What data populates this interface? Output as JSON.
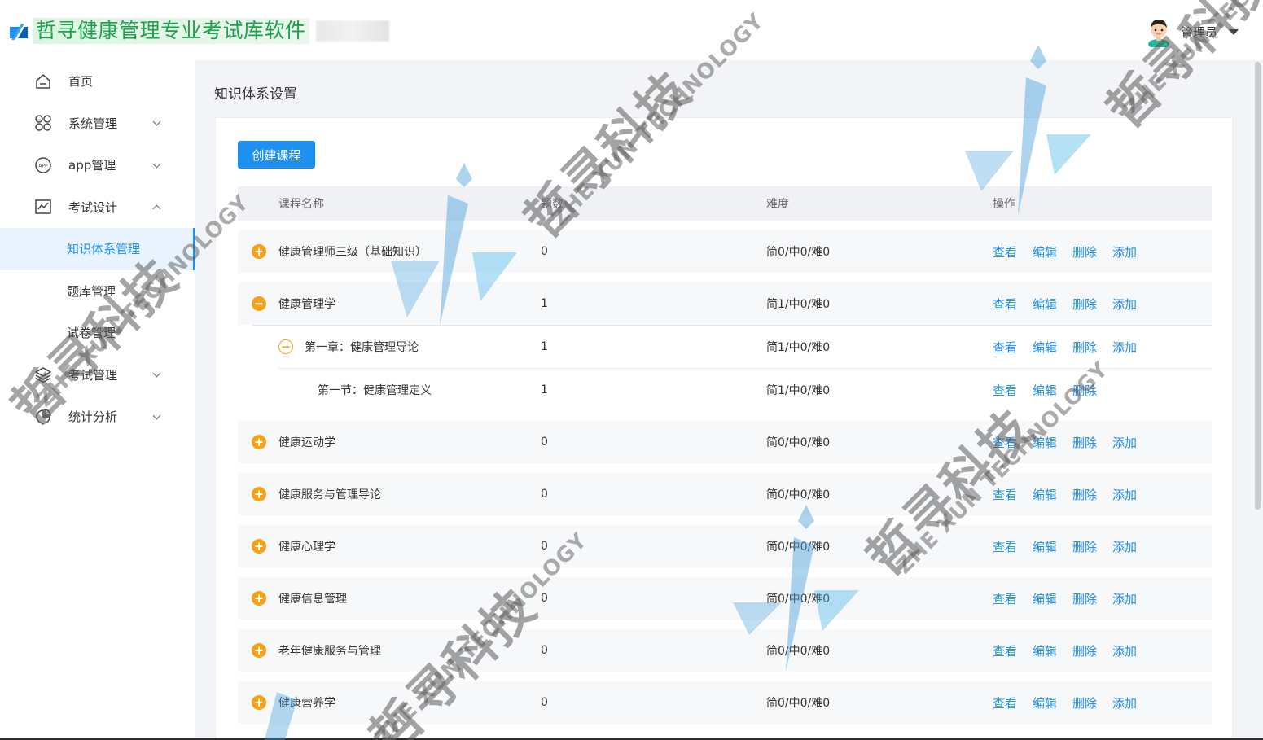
{
  "header": {
    "app_title": "哲寻健康管理专业考试库软件",
    "user_name": "管理员"
  },
  "sidebar": {
    "items": [
      {
        "label": "首页",
        "icon": "home-icon"
      },
      {
        "label": "系统管理",
        "icon": "grid-icon"
      },
      {
        "label": "app管理",
        "icon": "app-icon"
      },
      {
        "label": "考试设计",
        "icon": "chart-icon"
      },
      {
        "label": "考试管理",
        "icon": "layers-icon"
      },
      {
        "label": "统计分析",
        "icon": "pie-icon"
      }
    ],
    "sub_items": [
      {
        "label": "知识体系管理",
        "active": true
      },
      {
        "label": "题库管理"
      },
      {
        "label": "试卷管理"
      }
    ]
  },
  "main": {
    "page_title": "知识体系设置",
    "create_button": "创建课程",
    "columns": [
      "课程名称",
      "题数",
      "难度",
      "操作"
    ],
    "actions": {
      "view": "查看",
      "edit": "编辑",
      "delete": "删除",
      "add": "添加"
    },
    "rows": [
      {
        "name": "健康管理师三级（基础知识）",
        "count": "0",
        "difficulty": "简0/中0/难0"
      },
      {
        "name": "健康管理学",
        "count": "1",
        "difficulty": "简1/中0/难0"
      },
      {
        "name": "第一章：健康管理导论",
        "count": "1",
        "difficulty": "简1/中0/难0"
      },
      {
        "name": "第一节：健康管理定义",
        "count": "1",
        "difficulty": "简1/中0/难0"
      },
      {
        "name": "健康运动学",
        "count": "0",
        "difficulty": "简0/中0/难0"
      },
      {
        "name": "健康服务与管理导论",
        "count": "0",
        "difficulty": "简0/中0/难0"
      },
      {
        "name": "健康心理学",
        "count": "0",
        "difficulty": "简0/中0/难0"
      },
      {
        "name": "健康信息管理",
        "count": "0",
        "difficulty": "简0/中0/难0"
      },
      {
        "name": "老年健康服务与管理",
        "count": "0",
        "difficulty": "简0/中0/难0"
      },
      {
        "name": "健康营养学",
        "count": "0",
        "difficulty": "简0/中0/难0"
      }
    ]
  },
  "colors": {
    "primary": "#1e90f0",
    "toggle": "#f4a21a",
    "title_green": "#1aa34a"
  },
  "watermark": {
    "cn": "哲寻科技",
    "en": "ZHE XUN TECHNOLOGY"
  }
}
